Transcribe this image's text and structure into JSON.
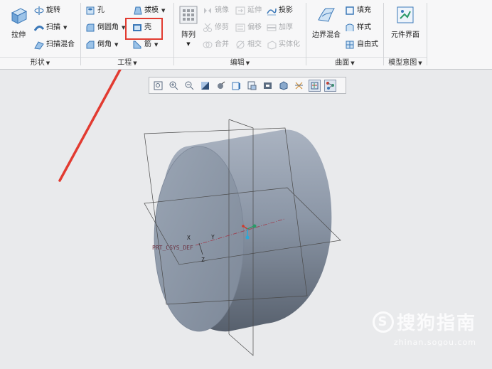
{
  "ribbon": {
    "shape_group": {
      "label": "形状",
      "extrude_label": "拉伸",
      "revolve_label": "旋转",
      "sweep_label": "扫描",
      "swept_blend_label": "扫描混合"
    },
    "engineering_group": {
      "label": "工程",
      "hole_label": "孔",
      "round_label": "倒圆角",
      "chamfer_label": "倒角",
      "draft_label": "拔模",
      "shell_label": "壳",
      "rib_label": "筋"
    },
    "edit_group": {
      "label": "编辑",
      "pattern_label": "阵列",
      "mirror_label": "镜像",
      "extend_label": "延伸",
      "project_label": "投影",
      "trim_label": "修剪",
      "offset_label": "偏移",
      "thicken_label": "加厚",
      "merge_label": "合并",
      "intersect_label": "相交",
      "solidify_label": "实体化"
    },
    "surfaces_group": {
      "label": "曲面",
      "boundary_blend_label": "边界混合",
      "fill_label": "填充",
      "style_label": "样式",
      "freestyle_label": "自由式"
    },
    "model_intent_group": {
      "label": "模型意图",
      "component_interface_label": "元件界面"
    }
  },
  "view_toolbar": {
    "icons": [
      "zoom-fit-icon",
      "zoom-in-icon",
      "zoom-out-icon",
      "repaint-icon",
      "display-style-icon",
      "saved-views-icon",
      "view-manager-icon",
      "perspective-icon",
      "section-icon",
      "datum-display-icon",
      "spin-center-icon",
      "annotation-display-icon"
    ]
  },
  "model": {
    "csys_label": "PRT_CSYS_DEF",
    "axis_x": "X",
    "axis_y": "Y",
    "axis_z": "Z"
  },
  "watermark": {
    "title": "搜狗指南",
    "url": "zhinan.sogou.com"
  },
  "colors": {
    "highlight": "#e23b31",
    "arrow": "#e23b31",
    "model_surface": "#8a95a6",
    "background": "#e9eaec"
  }
}
